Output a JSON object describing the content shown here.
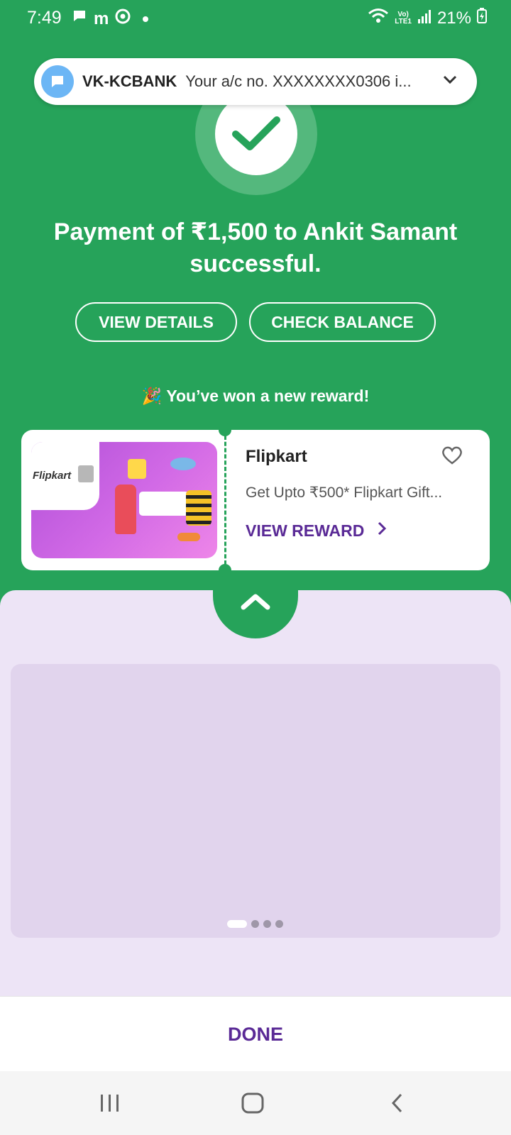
{
  "status_bar": {
    "time": "7:49",
    "battery_percent": "21%",
    "network_label_top": "Vo)",
    "network_label_bottom": "LTE1"
  },
  "notification": {
    "sender": "VK-KCBANK",
    "text": "Your a/c no. XXXXXXXX0306 i..."
  },
  "payment": {
    "title": "Payment of ₹1,500 to Ankit Samant successful."
  },
  "actions": {
    "view_details": "VIEW DETAILS",
    "check_balance": "CHECK BALANCE"
  },
  "reward": {
    "heading": "🎉 You’ve won a new reward!",
    "brand": "Flipkart",
    "logo_text": "Flipkart",
    "description": "Get Upto ₹500* Flipkart Gift...",
    "cta": "VIEW REWARD"
  },
  "carousel": {
    "active_index": 0,
    "count": 4
  },
  "footer": {
    "done": "DONE"
  },
  "colors": {
    "primary_green": "#26a35a",
    "accent_purple": "#5a2a96",
    "sheet_lavender": "#ede4f6"
  }
}
